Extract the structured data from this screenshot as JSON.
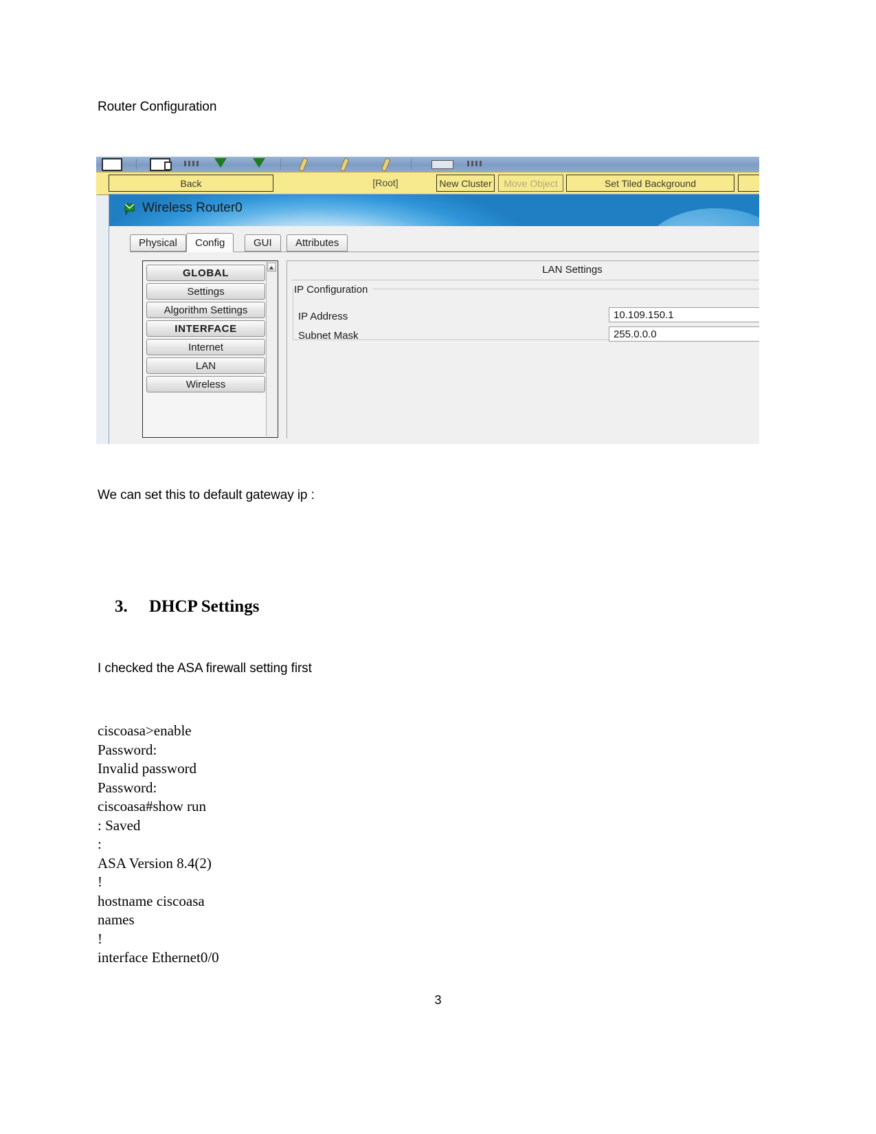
{
  "document": {
    "title_line": "Router Configuration",
    "gateway_line": "We can set this to default gateway ip :",
    "section_number": "3.",
    "section_title": "DHCP Settings",
    "asa_line": "I checked the ASA firewall setting first",
    "terminal_transcript": "ciscoasa>enable\nPassword:\nInvalid password\nPassword:\nciscoasa#show run\n: Saved\n:\nASA Version 8.4(2)\n!\nhostname ciscoasa\nnames\n!\ninterface Ethernet0/0",
    "page_number": "3"
  },
  "screenshot": {
    "navbar": {
      "back_label": "Back",
      "root_label": "[Root]",
      "new_cluster_label": "New Cluster",
      "move_object_label": "Move Object",
      "set_tiled_background_label": "Set Tiled Background"
    },
    "window": {
      "title": "Wireless Router0",
      "icon": "router-device-icon"
    },
    "tabs": [
      {
        "label": "Physical",
        "active": false
      },
      {
        "label": "Config",
        "active": true
      },
      {
        "label": "GUI",
        "active": false
      },
      {
        "label": "Attributes",
        "active": false
      }
    ],
    "sidebar": [
      {
        "label": "GLOBAL",
        "header": true
      },
      {
        "label": "Settings",
        "header": false
      },
      {
        "label": "Algorithm Settings",
        "header": false
      },
      {
        "label": "INTERFACE",
        "header": true
      },
      {
        "label": "Internet",
        "header": false
      },
      {
        "label": "LAN",
        "header": false
      },
      {
        "label": "Wireless",
        "header": false
      }
    ],
    "panel": {
      "heading": "LAN Settings",
      "group_label": "IP Configuration",
      "fields": [
        {
          "label": "IP Address",
          "value": "10.109.150.1"
        },
        {
          "label": "Subnet Mask",
          "value": "255.0.0.0"
        }
      ]
    },
    "colors": {
      "navbar_yellow": "#f7e98e",
      "toolstrip_blue": "#8fa9cd",
      "panel_gray": "#f0f0f0"
    }
  }
}
